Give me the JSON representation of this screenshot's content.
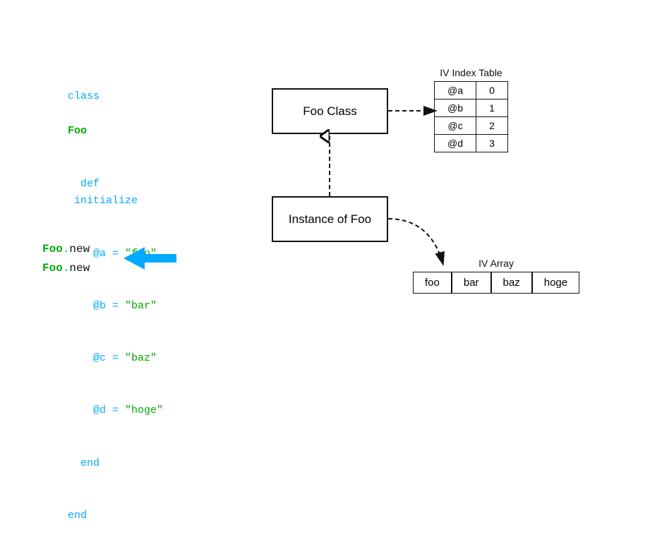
{
  "code": {
    "line1_kw": "class",
    "line1_name": "Foo",
    "line2": "  def initialize",
    "line3_at": "    @a",
    "line3_eq": " = ",
    "line3_val": "\"foo\"",
    "line4_at": "    @b",
    "line4_eq": " = ",
    "line4_val": "\"bar\"",
    "line5_at": "    @c",
    "line5_eq": " = ",
    "line5_val": "\"baz\"",
    "line6_at": "    @d",
    "line6_eq": " = ",
    "line6_val": "\"hoge\"",
    "line7": "  end",
    "line8": "end"
  },
  "foonew": {
    "line1_class": "Foo",
    "line1_dot": ".",
    "line1_method": "new",
    "line2_class": "Foo",
    "line2_dot": ".",
    "line2_method": "new"
  },
  "boxes": {
    "foo_class": "Foo Class",
    "instance": "Instance of Foo"
  },
  "iv_index_table": {
    "title": "IV Index Table",
    "rows": [
      {
        "var": "@a",
        "idx": "0"
      },
      {
        "var": "@b",
        "idx": "1"
      },
      {
        "var": "@c",
        "idx": "2"
      },
      {
        "var": "@d",
        "idx": "3"
      }
    ]
  },
  "iv_array": {
    "title": "IV Array",
    "cells": [
      "foo",
      "bar",
      "baz",
      "hoge"
    ]
  },
  "colors": {
    "blue": "#00aaff",
    "green": "#00aa00",
    "arrow_blue": "#00aaff"
  }
}
